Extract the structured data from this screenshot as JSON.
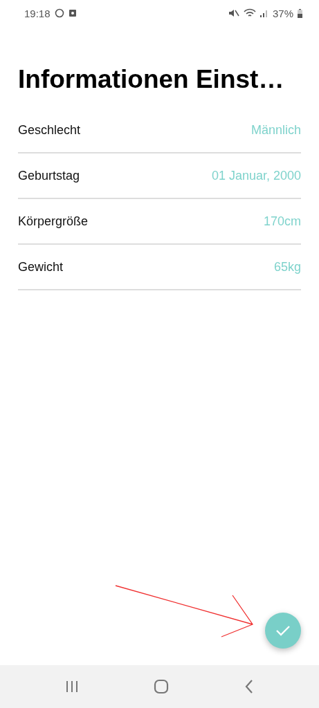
{
  "status_bar": {
    "time": "19:18",
    "battery": "37%"
  },
  "title": "Informationen Einst…",
  "rows": [
    {
      "label": "Geschlecht",
      "value": "Männlich"
    },
    {
      "label": "Geburtstag",
      "value": "01 Januar, 2000"
    },
    {
      "label": "Körpergröße",
      "value": "170cm"
    },
    {
      "label": "Gewicht",
      "value": "65kg"
    }
  ]
}
